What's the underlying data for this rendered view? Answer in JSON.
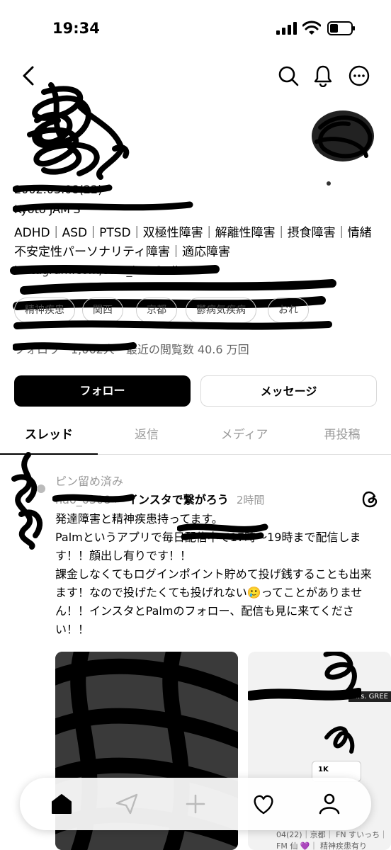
{
  "status_bar": {
    "time": "19:34"
  },
  "profile": {
    "birthdate": "2002.03.08(22)",
    "location": "Kyoto JAM'S",
    "bio": "ADHD｜ASD｜PTSD｜双極性障害｜解離性障害｜摂食障害｜情緒不安定性パーソナリティ障害｜適応障害",
    "link": "instagram.com/suia_love?sdh...",
    "tags": [
      "精神疾患",
      "関西",
      "京都",
      "鬱病気疾病",
      "おれ"
    ],
    "followers": "フォロワー1,062人",
    "recent_views": "・最近の閲覧数 40.6 万回"
  },
  "buttons": {
    "follow": "フォロー",
    "message": "メッセージ"
  },
  "tabs": [
    {
      "label": "スレッド",
      "active": true
    },
    {
      "label": "返信",
      "active": false
    },
    {
      "label": "メディア",
      "active": false
    },
    {
      "label": "再投稿",
      "active": false
    }
  ],
  "post": {
    "pinned_label": "ピン留め済み",
    "username": "nao_0308",
    "topic": "インスタで繋がろう",
    "age": "2時間",
    "lines": [
      "発達障害と精神疾患持ってます。",
      "Palmというアプリで毎日配信中で17時〜19時まで配信します！！顔出し有りです！！",
      "課金しなくてもログインポイント貯めて投げ銭することも出来ます！なので投げたくても投げれない🥲ってことがありません！！インスタとPalmのフォロー、配信も見に来てください！！"
    ]
  },
  "media_preview": {
    "card_label": "Mrs. GREE",
    "caption": "04(22)｜京都｜ FN すいっち｜FM 仙 💜｜ 精神疾患有り",
    "reaction_badge": "1K"
  },
  "icons": {
    "back": "chevron-left-icon",
    "search": "search-icon",
    "notifications": "bell-icon",
    "more": "more-horizontal-icon",
    "nav": [
      "home-icon",
      "send-icon",
      "plus-icon",
      "heart-icon",
      "profile-icon"
    ]
  },
  "colors": {
    "primary": "#000000",
    "muted": "#999999",
    "border": "#dddddd",
    "background": "#ffffff"
  }
}
